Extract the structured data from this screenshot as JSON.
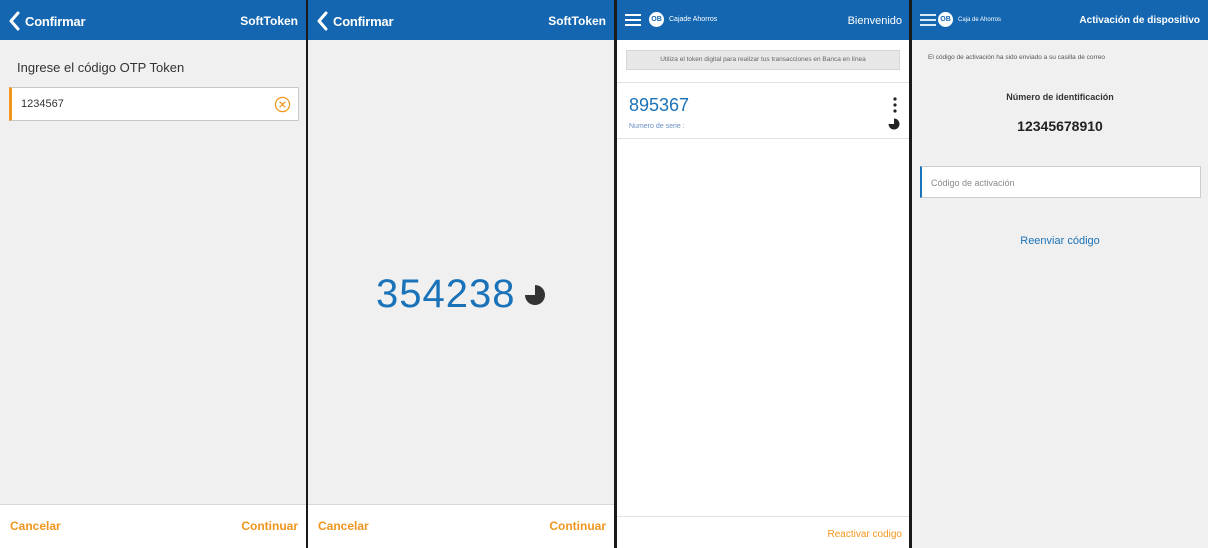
{
  "screen1": {
    "back_label": "Confirmar",
    "header_right": "SoftToken",
    "prompt": "Ingrese el código OTP Token",
    "otp_value": "1234567",
    "footer": {
      "left": "Cancelar",
      "right": "Continuar"
    }
  },
  "screen2": {
    "back_label": "Confirmar",
    "header_right": "SoftToken",
    "token_code": "354238",
    "footer": {
      "left": "Cancelar",
      "right": "Continuar"
    }
  },
  "screen3": {
    "logo_text": "OB",
    "brand": "Cajade Ahorros",
    "header_right": "Bienvenido",
    "banner": "Utiliza el token digital para realizar tus transacciones en Banca en línea",
    "token_code": "895367",
    "serial_label": "Numero de serie :",
    "footer_right": "Reactivar codigo"
  },
  "screen4": {
    "logo_text": "OB",
    "brand": "Caja de Ahorros",
    "header_right": "Activación de dispositivo",
    "info": "El código de activación ha sido enviado a su casilla de correo",
    "id_label": "Número de identificación",
    "id_value": "12345678910",
    "activation_placeholder": "Código de activación",
    "resend": "Reenviar código"
  },
  "colors": {
    "header": "#1466b0",
    "accent_orange": "#f0961e",
    "code_blue": "#1a72b8",
    "panel_bg": "#f0f0f0"
  },
  "icons": [
    "chevron-left-icon",
    "clear-circle-icon",
    "timer-pie-icon",
    "hamburger-menu-icon",
    "more-vertical-icon"
  ]
}
